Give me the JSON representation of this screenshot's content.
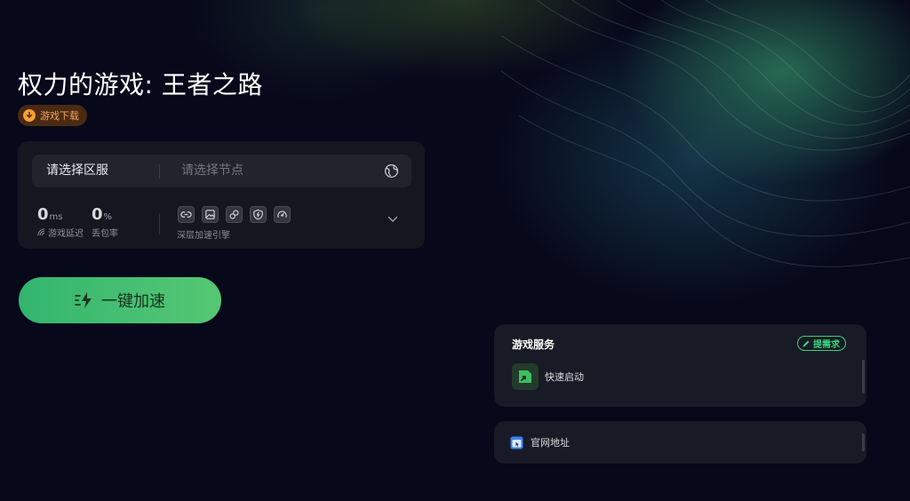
{
  "game": {
    "title": "权力的游戏: 王者之路",
    "download_label": "游戏下载"
  },
  "selector": {
    "region_label": "请选择区服",
    "node_placeholder": "请选择节点"
  },
  "stats": {
    "latency_value": "0",
    "latency_unit": "ms",
    "latency_label": "游戏延迟",
    "loss_value": "0",
    "loss_unit": "%",
    "loss_label": "丢包率"
  },
  "engine": {
    "label": "深层加速引擎",
    "icons": [
      "link-icon",
      "image-frame-icon",
      "chain-icon",
      "lightning-shield-icon",
      "speedometer-icon"
    ]
  },
  "accelerate": {
    "label": "一键加速"
  },
  "services": {
    "title": "游戏服务",
    "request_label": "提需求",
    "items": [
      {
        "label": "快速启动",
        "icon": "quick-launch-icon"
      }
    ]
  },
  "official_site": {
    "label": "官网地址",
    "icon": "browser-icon"
  },
  "colors": {
    "background": "#07081a",
    "accent_green": "#35d47a",
    "button_gradient_start": "#33b56e",
    "button_gradient_end": "#56c774",
    "download_badge_bg": "#4a2a13",
    "download_badge_text": "#f5a25a"
  }
}
